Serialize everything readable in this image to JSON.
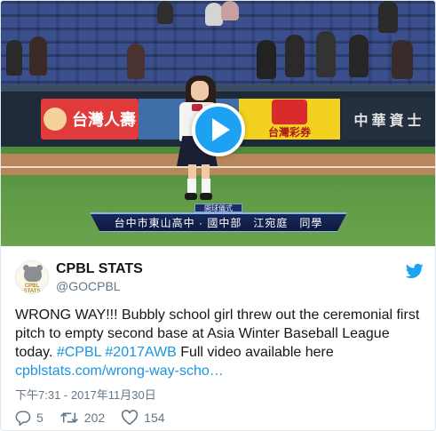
{
  "media": {
    "ad_red_text": "台灣人壽",
    "ad_dark_text": "中華資士",
    "ad_yellow_text": "台灣彩券",
    "caption_title": "開球儀式",
    "caption_text": "台中市東山高中 · 國中部　江宛庭　同學",
    "play_button": "play-icon"
  },
  "tweet": {
    "author_name": "CPBL STATS",
    "author_handle": "@GOCPBL",
    "avatar_text": "CPBL STATS",
    "text_part1": "WRONG WAY!!! Bubbly school girl threw out the ceremonial first pitch to empty second base at Asia Winter Baseball League today. ",
    "hashtag1": "#CPBL",
    "hashtag2": "#2017AWB",
    "text_part2": " Full video available here ",
    "link": "cpblstats.com/wrong-way-scho…",
    "timestamp": "下午7:31 - 2017年11月30日",
    "replies": "5",
    "retweets": "202",
    "likes": "154"
  },
  "colors": {
    "twitter_blue": "#1da1f2",
    "link_blue": "#1b95e0",
    "secondary_text": "#657786"
  },
  "icons": [
    "play-icon",
    "twitter-bird-icon",
    "reply-icon",
    "retweet-icon",
    "heart-icon"
  ]
}
